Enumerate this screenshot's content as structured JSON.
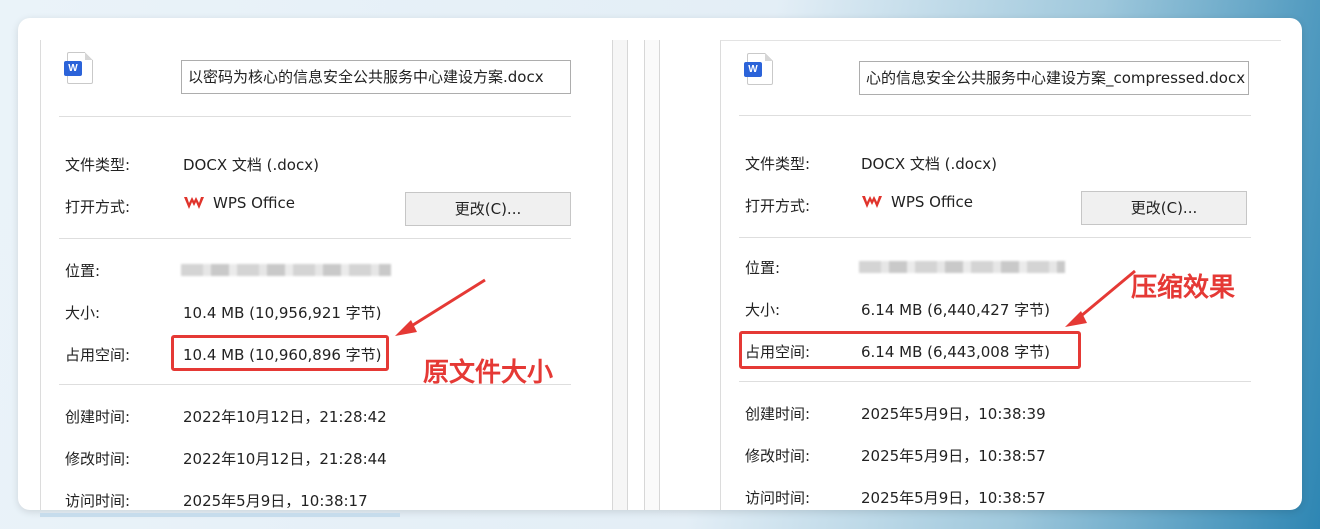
{
  "left": {
    "filename": "以密码为核心的信息安全公共服务中心建设方案.docx",
    "file_type_label": "文件类型:",
    "file_type_value": "DOCX 文档 (.docx)",
    "open_with_label": "打开方式:",
    "open_with_value": "WPS Office",
    "change_button": "更改(C)...",
    "location_label": "位置:",
    "size_label": "大小:",
    "size_value": "10.4 MB (10,956,921 字节)",
    "disk_label": "占用空间:",
    "disk_value": "10.4 MB (10,960,896 字节)",
    "created_label": "创建时间:",
    "created_value": "2022年10月12日，21:28:42",
    "modified_label": "修改时间:",
    "modified_value": "2022年10月12日，21:28:44",
    "accessed_label": "访问时间:",
    "accessed_value": "2025年5月9日，10:38:17",
    "annotation": "原文件大小"
  },
  "right": {
    "filename": "心的信息安全公共服务中心建设方案_compressed.docx",
    "file_type_label": "文件类型:",
    "file_type_value": "DOCX 文档 (.docx)",
    "open_with_label": "打开方式:",
    "open_with_value": "WPS Office",
    "change_button": "更改(C)...",
    "location_label": "位置:",
    "size_label": "大小:",
    "size_value": "6.14 MB (6,440,427 字节)",
    "disk_label": "占用空间:",
    "disk_value": "6.14 MB (6,443,008 字节)",
    "created_label": "创建时间:",
    "created_value": "2025年5月9日，10:38:39",
    "modified_label": "修改时间:",
    "modified_value": "2025年5月9日，10:38:57",
    "accessed_label": "访问时间:",
    "accessed_value": "2025年5月9日，10:38:57",
    "annotation": "压缩效果"
  },
  "icons": {
    "doc_badge": "W"
  },
  "colors": {
    "highlight": "#e53935",
    "word_blue": "#2b63d9",
    "wps_red": "#e0342c"
  }
}
